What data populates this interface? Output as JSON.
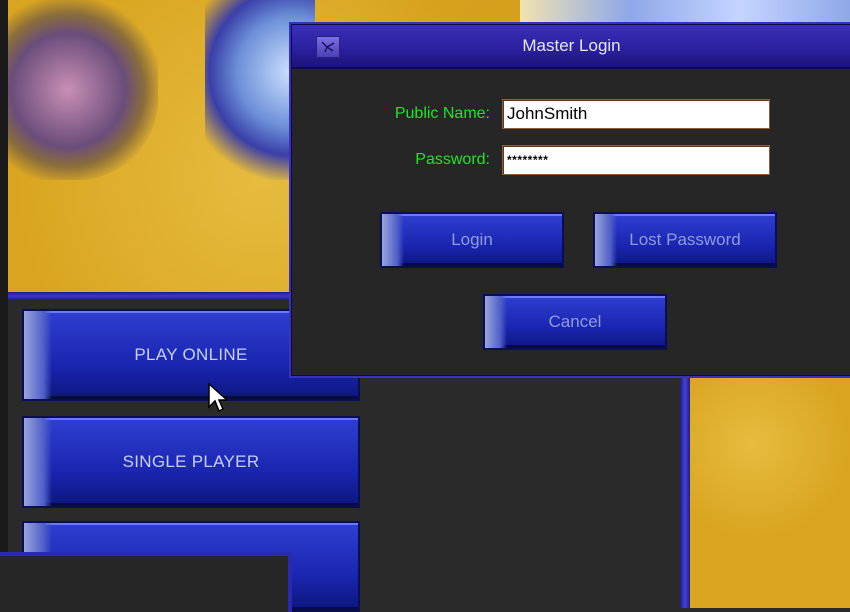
{
  "dialog": {
    "title": "Master Login",
    "public_name_label": "Public Name:",
    "public_name_value": "JohnSmith",
    "password_label": "Password:",
    "password_value": "********",
    "login_button": "Login",
    "lost_password_button": "Lost Password",
    "cancel_button": "Cancel"
  },
  "menu": {
    "items": [
      {
        "label": "PLAY ONLINE"
      },
      {
        "label": "SINGLE PLAYER"
      },
      {
        "label": ""
      }
    ]
  },
  "colors": {
    "label_green": "#22e22a",
    "button_blue": "#1a26b0",
    "background_gold": "#d9a520",
    "titlebar_purple": "#2a1f9c"
  },
  "icons": {
    "title_icon": "app-icon",
    "cursor": "mouse-cursor-icon"
  }
}
